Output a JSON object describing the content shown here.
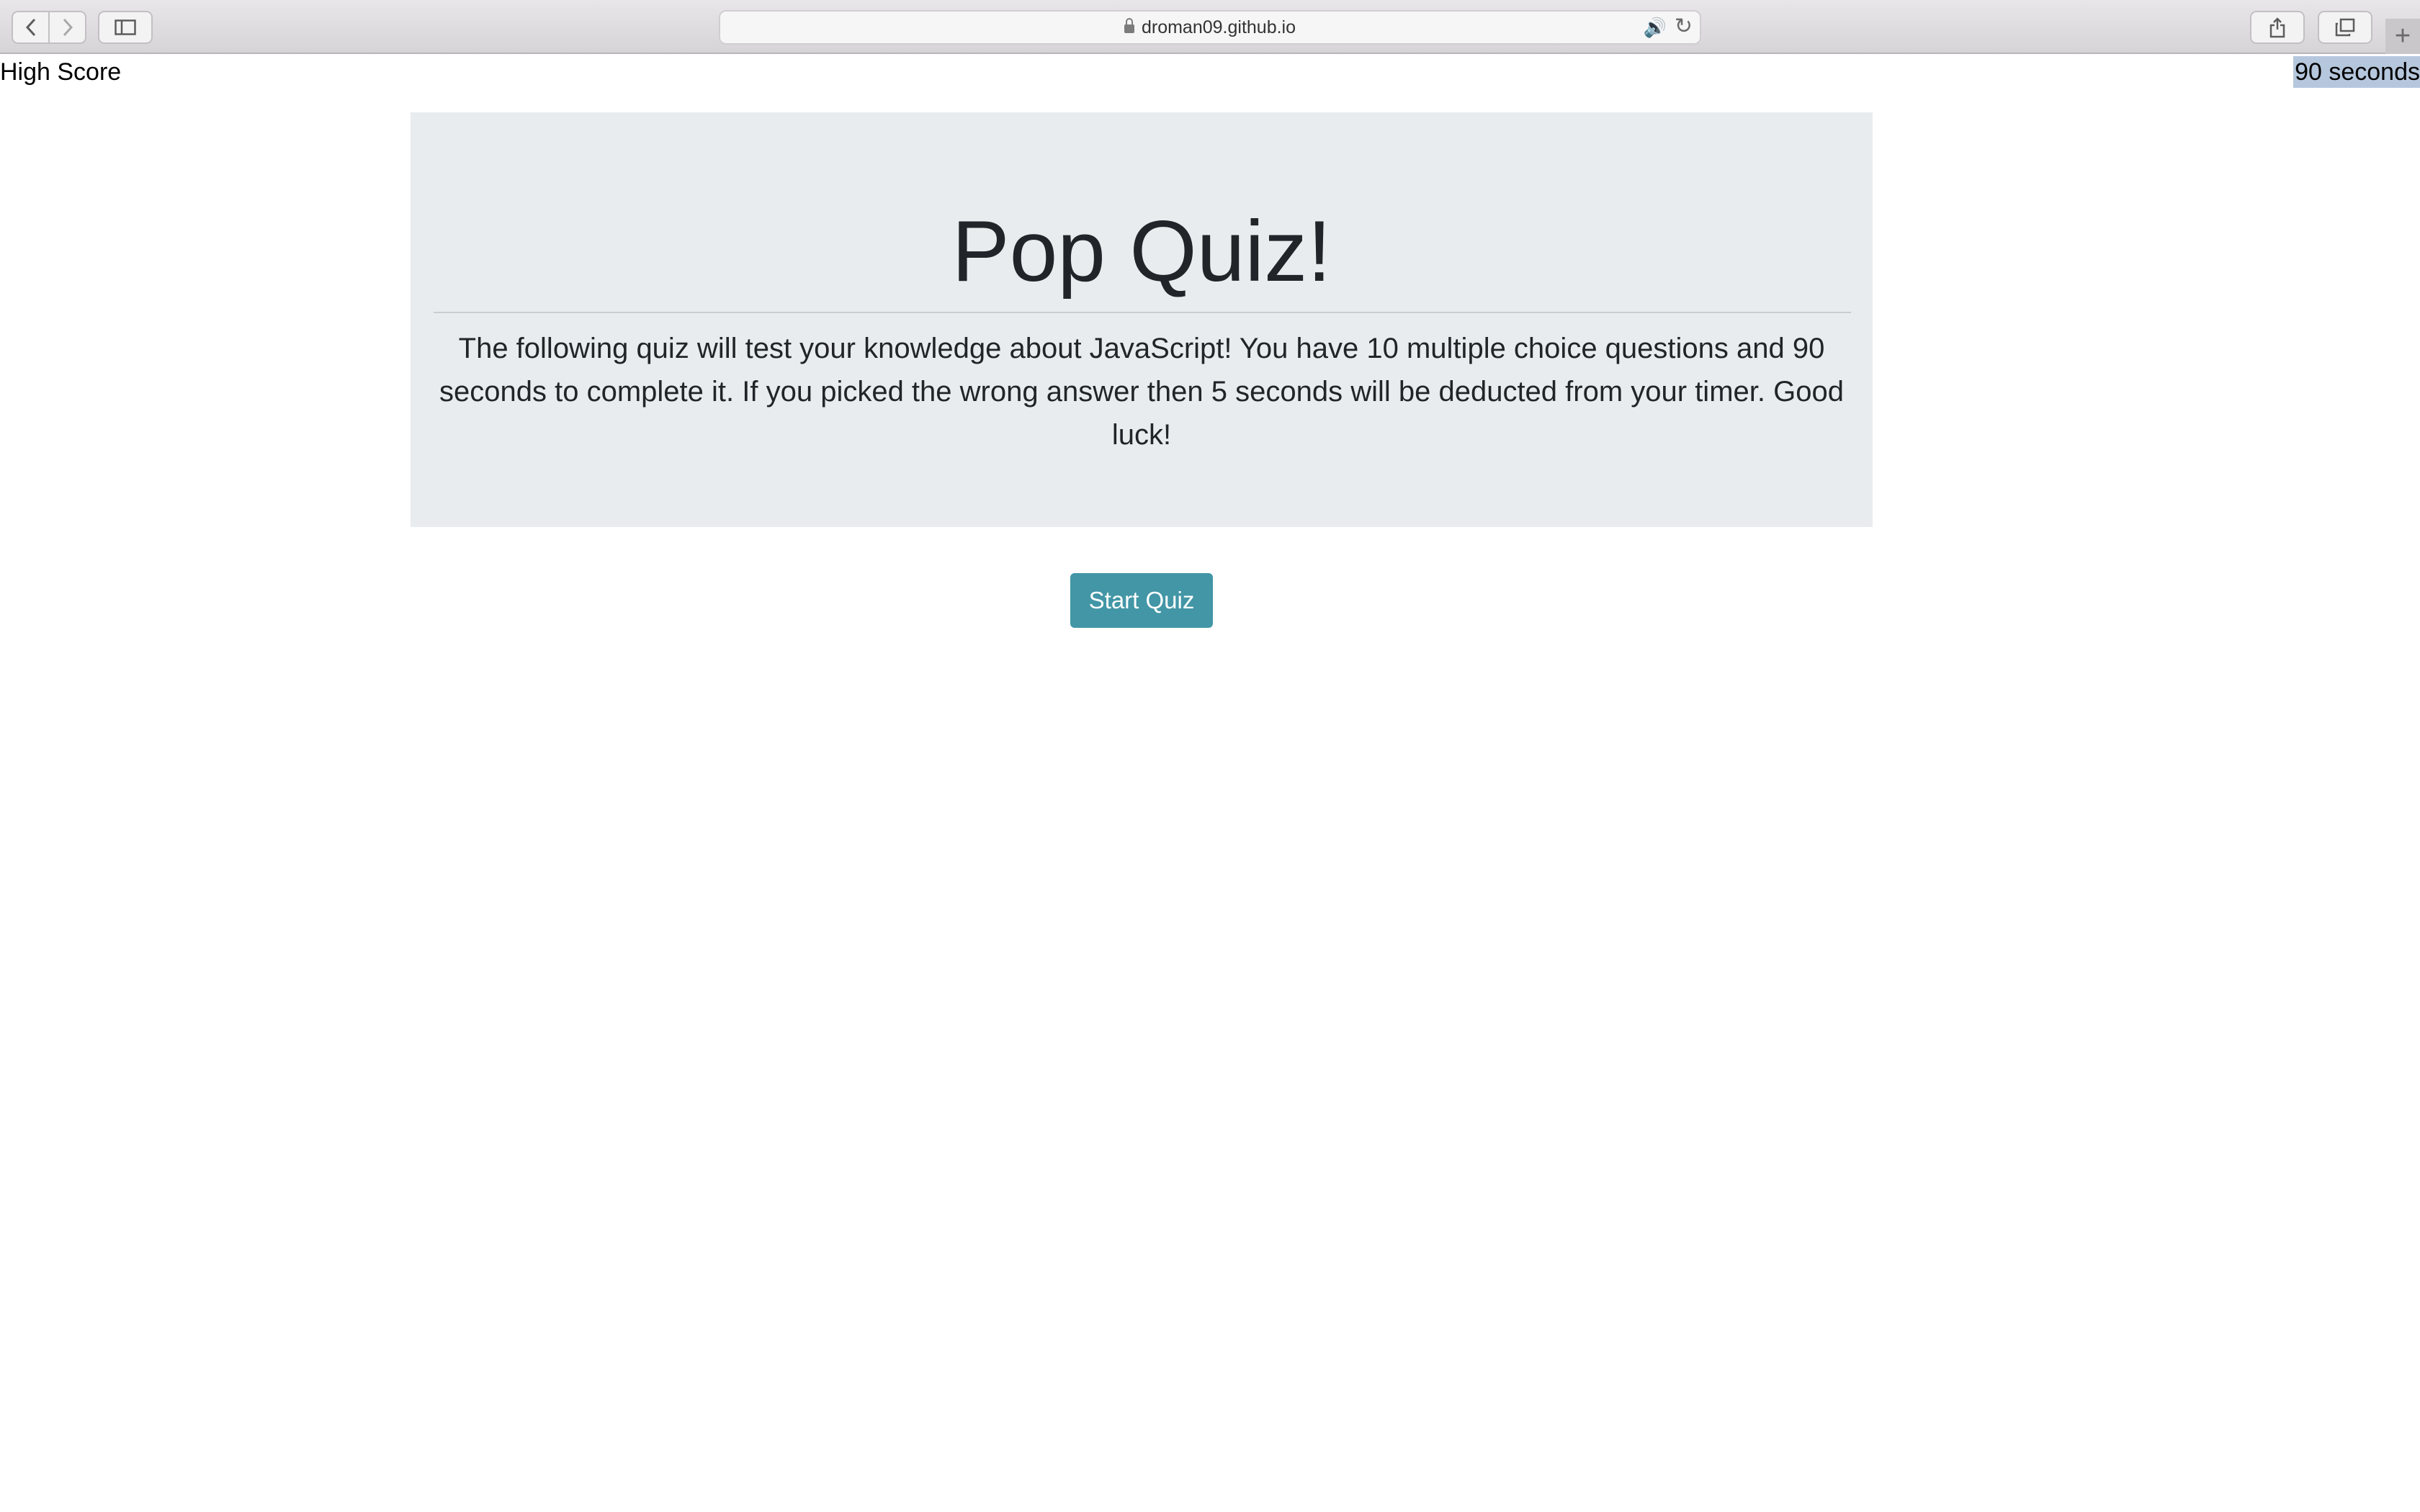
{
  "browser": {
    "url": "droman09.github.io",
    "icons": {
      "back": "chevron-left-icon",
      "forward": "chevron-right-icon",
      "sidebar": "sidebar-icon",
      "lock": "lock-icon",
      "audio": "speaker-icon",
      "reload": "reload-icon",
      "share": "share-icon",
      "tabs": "tabs-overview-icon",
      "new_tab": "plus-icon"
    }
  },
  "header": {
    "high_score_link": "High Score",
    "timer_text": "90 seconds"
  },
  "jumbotron": {
    "title": "Pop Quiz!",
    "description": "The following quiz will test your knowledge about JavaScript! You have 10 multiple choice questions and 90 seconds to complete it. If you picked the wrong answer then 5 seconds will be deducted from your timer. Good luck!"
  },
  "actions": {
    "start_label": "Start Quiz"
  },
  "colors": {
    "jumbotron_bg": "#e9ecef",
    "start_button_bg": "#4296a6",
    "timer_highlight": "#b5c7dc",
    "text": "#212529"
  }
}
